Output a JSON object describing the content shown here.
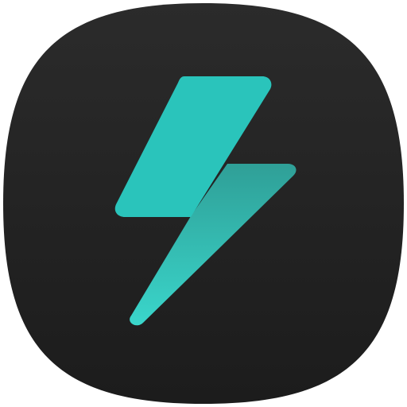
{
  "icon": {
    "name": "lightning-bolt-icon",
    "colors": {
      "background_outer": "#2b2b2b",
      "background_inner": "#1c1c1c",
      "bolt_primary": "#2ac4bb",
      "bolt_shadow": "#2f9f97",
      "bolt_highlight": "#3ad6cb"
    }
  }
}
